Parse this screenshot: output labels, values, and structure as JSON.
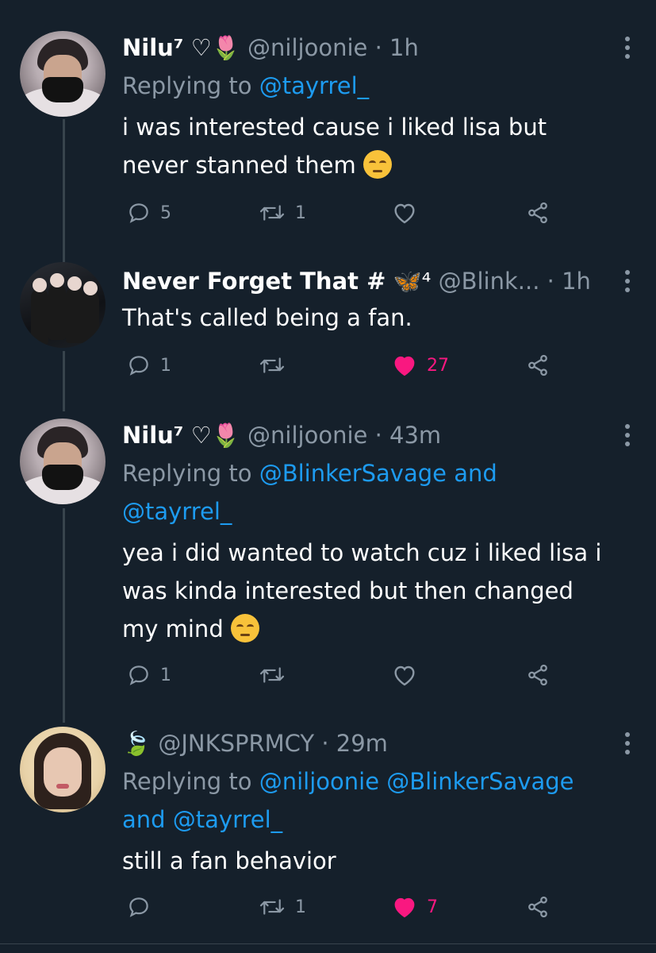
{
  "tweets": [
    {
      "name": "Nilu⁷",
      "badges": "♡🌷",
      "handle": "@niljoonie",
      "time": "1h",
      "replying_prefix": "Replying to",
      "replying_links": "@tayrrel_",
      "replying_links_2": "",
      "text_line1": "i was interested cause i liked lisa but",
      "text_line2": "never stanned them",
      "emoji": "pensive-face",
      "reply_count": "5",
      "retweet_count": "1",
      "like_count": "",
      "liked": false
    },
    {
      "name": "Never Forget That #",
      "badges": "🦋⁴",
      "handle": "@Blink...",
      "time": "1h",
      "text_line1": "That's called being a fan.",
      "reply_count": "1",
      "retweet_count": "",
      "like_count": "27",
      "liked": true
    },
    {
      "name": "Nilu⁷",
      "badges": "♡🌷",
      "handle": "@niljoonie",
      "time": "43m",
      "replying_prefix": "Replying to",
      "replying_links": "@BlinkerSavage and",
      "replying_links_2": "@tayrrel_",
      "text_line1": "yea i did wanted to watch cuz i liked lisa i",
      "text_line2": "was kinda interested but then changed",
      "text_line3": "my mind",
      "emoji": "pensive-face",
      "reply_count": "1",
      "retweet_count": "",
      "like_count": "",
      "liked": false
    },
    {
      "name": "",
      "badges": "🍃",
      "handle": "@JNKSPRMCY",
      "time": "29m",
      "replying_prefix": "Replying to",
      "replying_links": "@niljoonie @BlinkerSavage",
      "replying_links_2": "and @tayrrel_",
      "text_line1": "still a fan behavior",
      "reply_count": "",
      "retweet_count": "1",
      "like_count": "7",
      "liked": true
    }
  ],
  "separator": "·",
  "colors": {
    "background": "#15202b",
    "secondary_text": "#8b98a5",
    "link": "#1d9bf0",
    "like": "#f91880"
  }
}
